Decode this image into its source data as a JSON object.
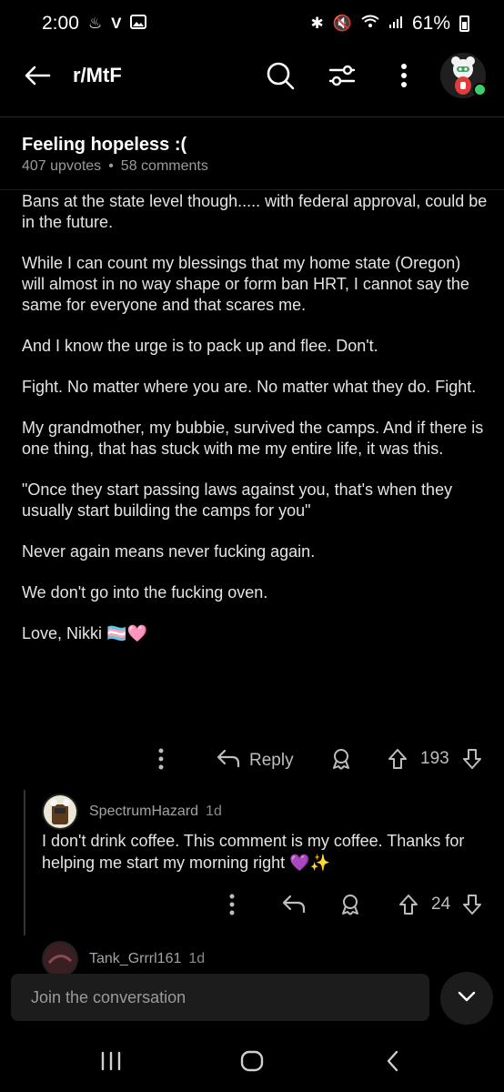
{
  "status_bar": {
    "time": "2:00",
    "battery": "61%"
  },
  "header": {
    "subreddit": "r/MtF",
    "icons": [
      "back-arrow-icon",
      "search-icon",
      "filter-icon",
      "more-vertical-icon",
      "avatar"
    ]
  },
  "post": {
    "title": "Feeling hopeless :(",
    "upvotes": "407 upvotes",
    "separator": "•",
    "comments": "58 comments"
  },
  "comment": {
    "paragraphs": [
      "Bans at the state level though..... with federal approval, could be in the future.",
      "While I can count my blessings that my home state (Oregon) will almost in no way shape or form ban HRT, I cannot say the same for everyone and that scares me.",
      "And I know the urge is to pack up and flee. Don't.",
      "Fight. No matter where you are. No matter what they do. Fight.",
      "My grandmother, my bubbie, survived the camps. And if there is one thing, that has stuck with me my entire life, it was this.",
      "\"Once they start passing laws against you, that's when they usually start building the camps for you\"",
      "Never again means never fucking again.",
      "We don't go into the fucking oven.",
      "Love, Nikki 🏳️‍⚧️🩷"
    ],
    "reply_label": "Reply",
    "score": "193"
  },
  "reply": {
    "username": "SpectrumHazard",
    "time": "1d",
    "body": "I don't drink coffee. This comment is my coffee. Thanks for helping me start my morning right 💜✨",
    "score": "24"
  },
  "next_comment": {
    "username": "Tank_Grrrl161",
    "time": "1d"
  },
  "composer": {
    "placeholder": "Join the conversation"
  },
  "colors": {
    "background": "#000000",
    "accent_green": "#3ecf6a",
    "muted": "#9a9a9a"
  }
}
